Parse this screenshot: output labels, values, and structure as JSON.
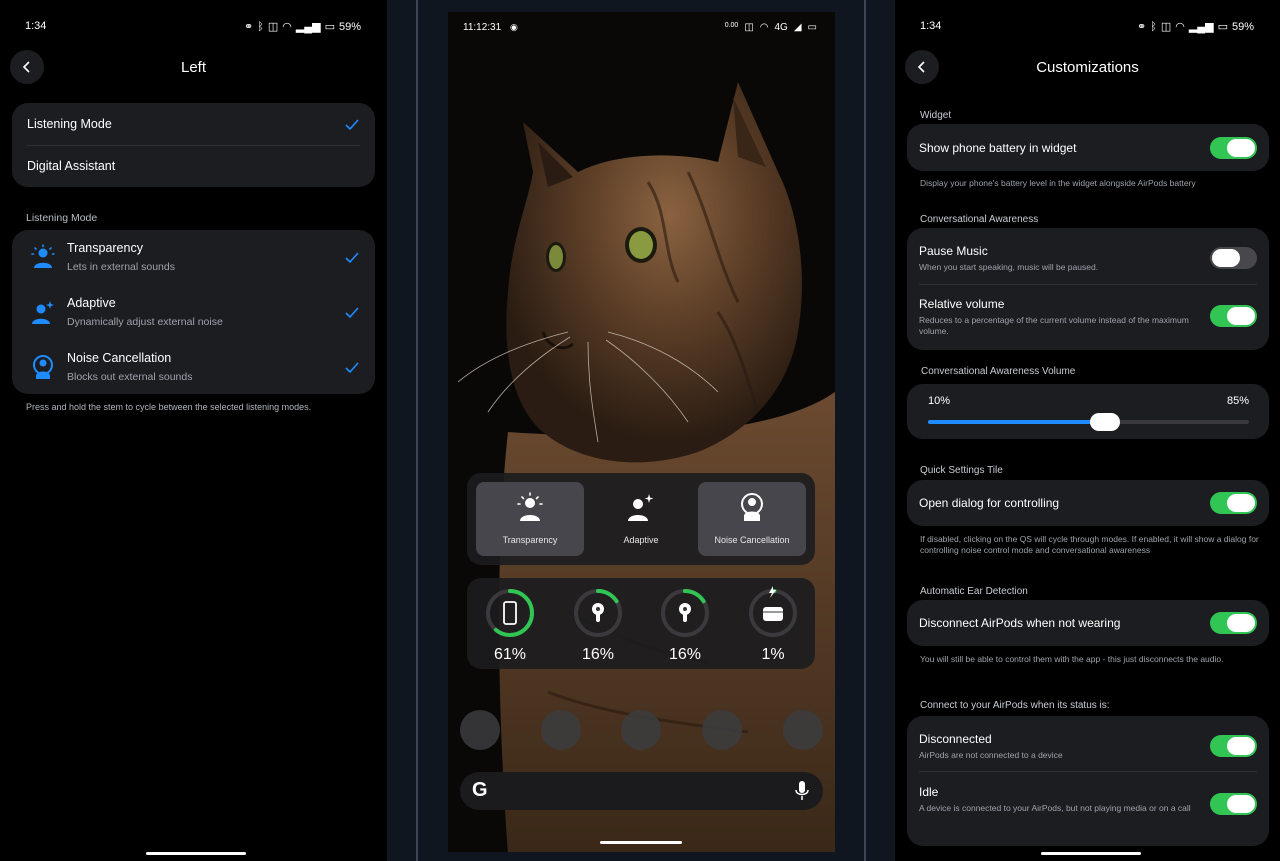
{
  "left": {
    "status_time": "1:34",
    "status_battery": "59%",
    "title": "Left",
    "actions": [
      {
        "label": "Listening Mode",
        "checked": true
      },
      {
        "label": "Digital Assistant",
        "checked": false
      }
    ],
    "section_title": "Listening Mode",
    "modes": [
      {
        "label": "Transparency",
        "sub": "Lets in external sounds",
        "icon": "transparency-icon",
        "checked": true
      },
      {
        "label": "Adaptive",
        "sub": "Dynamically adjust external noise",
        "icon": "adaptive-icon",
        "checked": true
      },
      {
        "label": "Noise Cancellation",
        "sub": "Blocks out external sounds",
        "icon": "noise-cancellation-icon",
        "checked": true
      }
    ],
    "footer": "Press and hold the stem to cycle between the selected listening modes.",
    "accent": "#1e8cff"
  },
  "middle": {
    "status_time": "11:12:31",
    "status_net": "4G",
    "status_speed": "0.00",
    "noise_modes": [
      {
        "label": "Transparency",
        "active": true
      },
      {
        "label": "Adaptive",
        "active": false
      },
      {
        "label": "Noise Cancellation",
        "active": true
      }
    ],
    "batteries": [
      {
        "device": "phone-icon",
        "percent": "61%",
        "level": 0.61
      },
      {
        "device": "left-airpod-icon",
        "percent": "16%",
        "level": 0.16
      },
      {
        "device": "right-airpod-icon",
        "percent": "16%",
        "level": 0.16
      },
      {
        "device": "airpods-case-icon",
        "percent": "1%",
        "level": 0.01,
        "charging": true
      }
    ],
    "search_logo": "G"
  },
  "right": {
    "status_time": "1:34",
    "status_battery": "59%",
    "title": "Customizations",
    "widget": {
      "head": "Widget",
      "label": "Show phone battery in widget",
      "on": true,
      "note": "Display your phone's battery level in the widget alongside AirPods battery"
    },
    "conv": {
      "head": "Conversational Awareness",
      "pause_label": "Pause Music",
      "pause_sub": "When you start speaking, music will be paused.",
      "pause_on": false,
      "relative_label": "Relative volume",
      "relative_sub": "Reduces to a percentage of the current volume instead of the maximum volume.",
      "relative_on": true
    },
    "volume": {
      "head": "Conversational Awareness Volume",
      "min": "10%",
      "max": "85%",
      "level": 0.55
    },
    "qs": {
      "head": "Quick Settings Tile",
      "label": "Open dialog for controlling",
      "on": true,
      "note": "If disabled, clicking on the QS will cycle through modes. If enabled, it will show a dialog for controlling noise control mode and conversational awareness"
    },
    "ear": {
      "head": "Automatic Ear Detection",
      "label": "Disconnect AirPods when not wearing",
      "on": true,
      "note": "You will still be able to control them with the app - this just disconnects the audio."
    },
    "connect": {
      "head": "Connect to your AirPods when its status is:",
      "items": [
        {
          "label": "Disconnected",
          "sub": "AirPods are not connected to a device",
          "on": true
        },
        {
          "label": "Idle",
          "sub": "A device is connected to your AirPods, but not playing media or on a call",
          "on": true
        }
      ]
    }
  }
}
